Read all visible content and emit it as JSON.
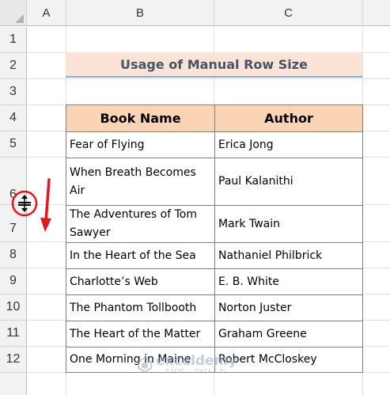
{
  "columns": [
    "A",
    "B",
    "C"
  ],
  "rows": [
    "1",
    "2",
    "3",
    "4",
    "5",
    "6",
    "7",
    "8",
    "9",
    "10",
    "11",
    "12"
  ],
  "title": "Usage of Manual Row Size",
  "table": {
    "headers": [
      "Book Name",
      "Author"
    ],
    "rows": [
      [
        "Fear of Flying",
        "Erica Jong"
      ],
      [
        "When Breath Becomes Air",
        "Paul Kalanithi"
      ],
      [
        "The Adventures of Tom Sawyer",
        "Mark Twain"
      ],
      [
        "In the Heart of the Sea",
        "Nathaniel Philbrick"
      ],
      [
        "Charlotte’s Web",
        "E. B. White"
      ],
      [
        "The Phantom Tollbooth",
        "Norton Juster"
      ],
      [
        "The Heart of the Matter",
        "Graham Greene"
      ],
      [
        "One Morning in Maine",
        "Robert McCloskey"
      ]
    ]
  },
  "watermark": {
    "name": "exceldemy",
    "tagline": "EXCEL · DATA · BI"
  },
  "colors": {
    "title_fill": "#fbe3d6",
    "header_fill": "#fbd3b5",
    "title_text": "#44546a",
    "highlight": "#e8141b"
  },
  "icons": [
    "row-resize-cursor-icon",
    "down-arrow-icon",
    "highlight-circle-icon",
    "exceldemy-logo-icon"
  ]
}
